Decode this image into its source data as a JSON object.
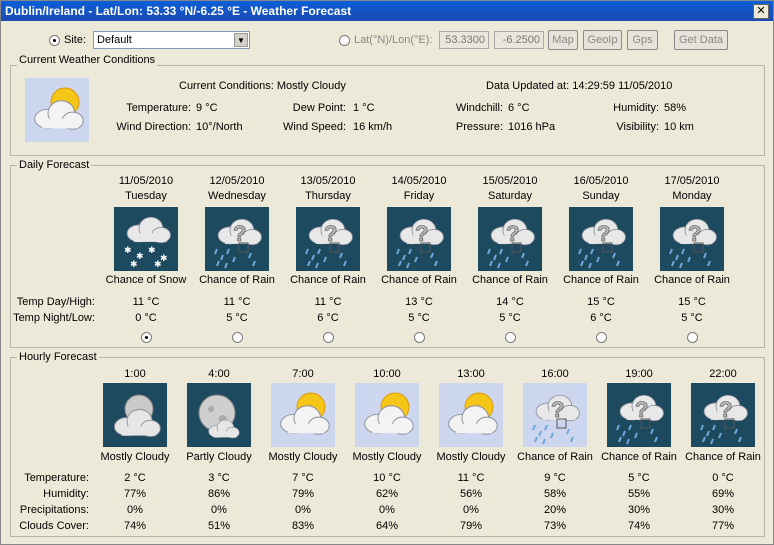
{
  "window": {
    "title": "Dublin/Ireland - Lat/Lon: 53.33 °N/-6.25 °E - Weather Forecast",
    "close": "✕"
  },
  "toolbar": {
    "site_label": "Site:",
    "site_value": "Default",
    "latlon_label": "Lat(°N)/Lon(°E):",
    "lat_value": "53.3300",
    "lon_value": "-6.2500",
    "map_label": "Map",
    "geoip_label": "GeoIp",
    "gps_label": "Gps",
    "getdata_label": "Get Data"
  },
  "current": {
    "group_label": "Current Weather Conditions",
    "icon": "cloud-sun-icon",
    "conditions": "Current Conditions: Mostly Cloudy",
    "updated": "Data Updated at: 14:29:59 11/05/2010",
    "temperature_label": "Temperature:",
    "temperature": "9 °C",
    "dewpoint_label": "Dew Point:",
    "dewpoint": "1 °C",
    "windchill_label": "Windchill:",
    "windchill": "6 °C",
    "humidity_label": "Humidity:",
    "humidity": "58%",
    "winddir_label": "Wind Direction:",
    "winddir": "10°/North",
    "windspeed_label": "Wind Speed:",
    "windspeed": "16 km/h",
    "pressure_label": "Pressure:",
    "pressure": "1016 hPa",
    "visibility_label": "Visibility:",
    "visibility": "10 km"
  },
  "daily": {
    "group_label": "Daily Forecast",
    "day_high_label": "Temp Day/High:",
    "night_low_label": "Temp Night/Low:",
    "selected_index": 0,
    "days": [
      {
        "date": "11/05/2010",
        "weekday": "Tuesday",
        "icon": "snow-icon",
        "summary": "Chance of Snow",
        "high": "11 °C",
        "low": "0 °C"
      },
      {
        "date": "12/05/2010",
        "weekday": "Wednesday",
        "icon": "rain-icon",
        "summary": "Chance of Rain",
        "high": "11 °C",
        "low": "5 °C"
      },
      {
        "date": "13/05/2010",
        "weekday": "Thursday",
        "icon": "rain-icon",
        "summary": "Chance of Rain",
        "high": "11 °C",
        "low": "6 °C"
      },
      {
        "date": "14/05/2010",
        "weekday": "Friday",
        "icon": "rain-icon",
        "summary": "Chance of Rain",
        "high": "13 °C",
        "low": "5 °C"
      },
      {
        "date": "15/05/2010",
        "weekday": "Saturday",
        "icon": "rain-icon",
        "summary": "Chance of Rain",
        "high": "14 °C",
        "low": "5 °C"
      },
      {
        "date": "16/05/2010",
        "weekday": "Sunday",
        "icon": "rain-icon",
        "summary": "Chance of Rain",
        "high": "15 °C",
        "low": "6 °C"
      },
      {
        "date": "17/05/2010",
        "weekday": "Monday",
        "icon": "rain-icon",
        "summary": "Chance of Rain",
        "high": "15 °C",
        "low": "5 °C"
      }
    ]
  },
  "hourly": {
    "group_label": "Hourly Forecast",
    "temperature_label": "Temperature:",
    "humidity_label": "Humidity:",
    "precip_label": "Precipitations:",
    "clouds_label": "Clouds Cover:",
    "hours": [
      {
        "time": "1:00",
        "icon": "cloud-moon-icon",
        "summary": "Mostly Cloudy",
        "temp": "2 °C",
        "humidity": "77%",
        "precip": "0%",
        "clouds": "74%"
      },
      {
        "time": "4:00",
        "icon": "moon-icon",
        "summary": "Partly Cloudy",
        "temp": "3 °C",
        "humidity": "86%",
        "precip": "0%",
        "clouds": "51%"
      },
      {
        "time": "7:00",
        "icon": "cloud-sun-icon",
        "summary": "Mostly Cloudy",
        "temp": "7 °C",
        "humidity": "79%",
        "precip": "0%",
        "clouds": "83%"
      },
      {
        "time": "10:00",
        "icon": "cloud-sun-icon",
        "summary": "Mostly Cloudy",
        "temp": "10 °C",
        "humidity": "62%",
        "precip": "0%",
        "clouds": "64%"
      },
      {
        "time": "13:00",
        "icon": "cloud-sun-icon",
        "summary": "Mostly Cloudy",
        "temp": "11 °C",
        "humidity": "56%",
        "precip": "0%",
        "clouds": "79%"
      },
      {
        "time": "16:00",
        "icon": "rain-day-icon",
        "summary": "Chance of Rain",
        "temp": "9 °C",
        "humidity": "58%",
        "precip": "20%",
        "clouds": "73%"
      },
      {
        "time": "19:00",
        "icon": "rain-icon",
        "summary": "Chance of Rain",
        "temp": "5 °C",
        "humidity": "55%",
        "precip": "30%",
        "clouds": "74%"
      },
      {
        "time": "22:00",
        "icon": "rain-icon",
        "summary": "Chance of Rain",
        "temp": "0 °C",
        "humidity": "69%",
        "precip": "30%",
        "clouds": "77%"
      }
    ]
  },
  "colors": {
    "titlebar": "#0a5fd6",
    "night_bg": "#1d4a5e",
    "day_bg": "#cdd6ef"
  }
}
